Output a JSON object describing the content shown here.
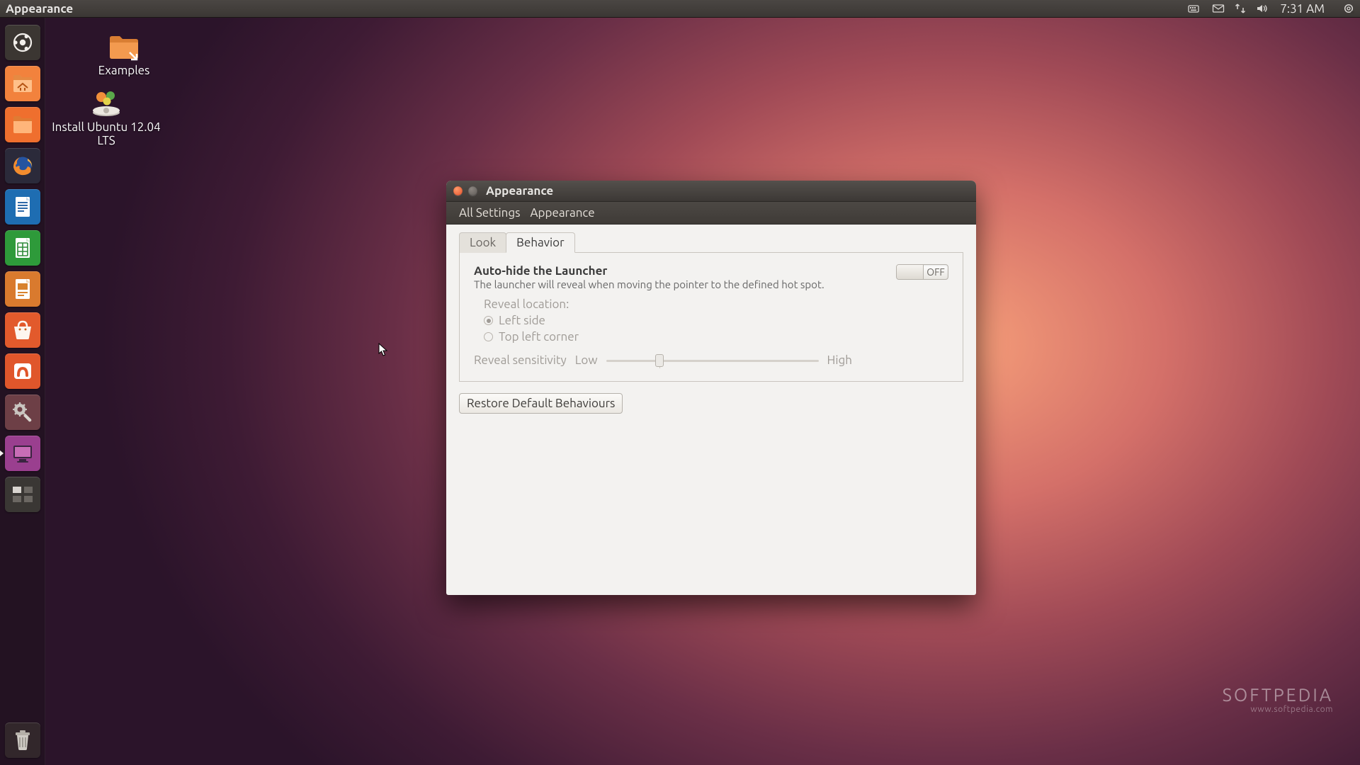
{
  "top_panel": {
    "active_app": "Appearance",
    "clock": "7:31 AM"
  },
  "launcher": {
    "items": [
      {
        "name": "dash-home",
        "bg": "#3b3632"
      },
      {
        "name": "nautilus-home",
        "bg": "#f07f3b"
      },
      {
        "name": "nautilus-files",
        "bg": "#ef6f2e"
      },
      {
        "name": "firefox",
        "bg": "#2b2a3a"
      },
      {
        "name": "libreoffice-writer",
        "bg": "#1e6db2"
      },
      {
        "name": "libreoffice-calc",
        "bg": "#2e9a3a"
      },
      {
        "name": "libreoffice-impress",
        "bg": "#d97a2e"
      },
      {
        "name": "ubuntu-software",
        "bg": "#e25a2c"
      },
      {
        "name": "ubuntu-one",
        "bg": "#e0562b"
      },
      {
        "name": "system-settings",
        "bg": "#6d3f46"
      },
      {
        "name": "appearance",
        "bg": "#9a3f8f",
        "running": true
      },
      {
        "name": "workspace-switcher",
        "bg": "#3a3734"
      }
    ],
    "trash_name": "trash"
  },
  "desktop": {
    "examples_label": "Examples",
    "install_label": "Install Ubuntu 12.04 LTS"
  },
  "window": {
    "title": "Appearance",
    "toolbar": {
      "all_settings": "All Settings",
      "current": "Appearance"
    },
    "tabs": {
      "look": "Look",
      "behavior": "Behavior"
    },
    "behavior": {
      "heading": "Auto-hide the Launcher",
      "desc": "The launcher will reveal when moving the pointer to the defined hot spot.",
      "switch_state": "OFF",
      "reveal_label": "Reveal location:",
      "opt_left": "Left side",
      "opt_corner": "Top left corner",
      "sensitivity_label": "Reveal sensitivity",
      "sens_low": "Low",
      "sens_high": "High",
      "restore": "Restore Default Behaviours"
    }
  },
  "watermark": {
    "brand": "SOFTPEDIA",
    "url": "www.softpedia.com"
  }
}
